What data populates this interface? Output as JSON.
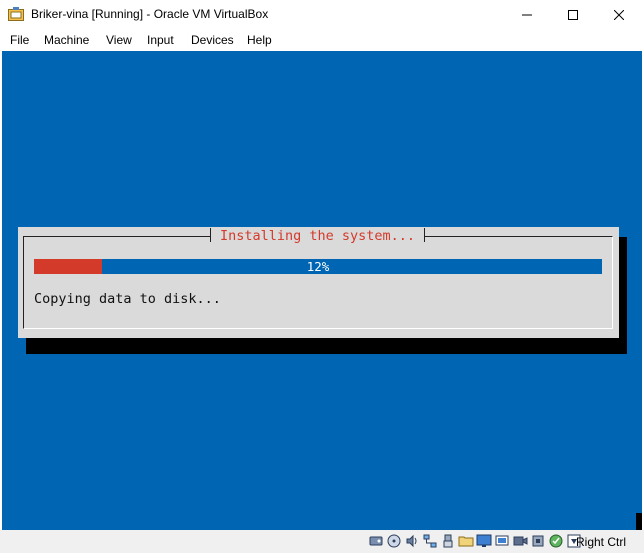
{
  "window": {
    "title": "Briker-vina [Running] - Oracle VM VirtualBox"
  },
  "menu": {
    "items": [
      {
        "label": "File"
      },
      {
        "label": "Machine"
      },
      {
        "label": "View"
      },
      {
        "label": "Input"
      },
      {
        "label": "Devices"
      },
      {
        "label": "Help"
      }
    ]
  },
  "installer": {
    "title": "Installing the system...",
    "progress_percent": 12,
    "progress_label": "12%",
    "status": "Copying data to disk..."
  },
  "statusbar": {
    "icons": [
      "hard-disk-icon",
      "optical-drive-icon",
      "audio-icon",
      "network-icon",
      "usb-icon",
      "shared-folders-icon",
      "display-icon",
      "screen-capture-icon",
      "recording-icon",
      "cpu-icon",
      "mouse-integration-icon",
      "keyboard-capture-icon"
    ],
    "host_key_label": "Right Ctrl"
  },
  "colors": {
    "guest_background": "#0066b4",
    "dialog_background": "#dadada",
    "progress_fill": "#d43a2a",
    "title_text": "#d43a2a"
  }
}
